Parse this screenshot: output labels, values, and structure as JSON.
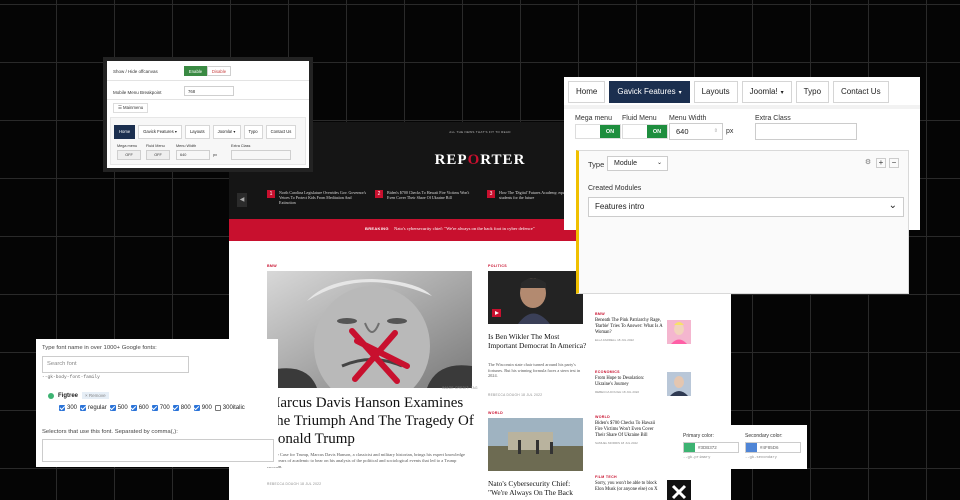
{
  "site": {
    "date_line": "ALL THE NEWS THAT'S FIT TO READ",
    "logo_before": "REP",
    "logo_mark": "O",
    "logo_after": "RTER",
    "ticker": [
      {
        "num": "1",
        "text": "North Carolina Legislature Overrides Gov. Governor's Vetoes To Protect Kids From Meditation And Extinction"
      },
      {
        "num": "2",
        "text": "Biden's $700 Checks To Hawaii Fire Victims Won't Even Cover Their Share Of Ukraine Bill"
      },
      {
        "num": "3",
        "text": "How The 'Digital' Futures Academy, equipping students for the future"
      }
    ],
    "breaking_label": "BREAKING",
    "breaking_text": "Nato's cybersecurity chief: \"We're always on the back foot in cyber defence\"",
    "main_category": "BMW",
    "photo_credit": "IMAGE CREDIT: TAG",
    "headline": "Marcus Davis Hanson Examines The Triumph And The Tragedy Of Donald Trump",
    "excerpt": "In The Case for Trump, Marcus Davis Hanson, a classicist and military historian, brings his expert knowledge from years of academic to bear on his analysis of the political and sociological events that led to a Trump election.",
    "main_byline": "REBECCA DOUGH   18 JUL 2022",
    "mid": [
      {
        "category": "POLITICS",
        "title": "Is Ben Wikler The Most Important Democrat In America?",
        "excerpt": "The Wisconsin state chair turned around his party's fortunes. But his winning formula faces a stern test in 2024.",
        "byline": "REBECCA DOUGH   18 JUL 2022"
      },
      {
        "category": "WORLD",
        "title": "Nato's Cybersecurity Chief: \"We're Always On The Back",
        "excerpt": "",
        "byline": ""
      }
    ],
    "right": [
      {
        "category": "ECONOMICS",
        "title": "The polling data that shows the Tories could recover",
        "byline": "REBECCA DOUGH   18 JUL 2022"
      },
      {
        "category": "BMW",
        "title": "Beneath The Pink Patriarchy Rage, 'Barbie' Tries To Answer: What Is A Woman?",
        "byline": "ELLA FARRELL   18 JUL 2022"
      },
      {
        "category": "ECONOMICS",
        "title": "From Hope to Desolation: Ukraine's Journey",
        "byline": "REBECCA DOUGH   18 JUL 2022"
      },
      {
        "category": "WORLD",
        "title": "Biden's $700 Checks To Hawaii Fire Victims Won't Even Cover Their Share Of Ukraine Bill",
        "byline": "SAMUEL MORRIS   18 JUL 2022"
      },
      {
        "category": "FILM TECH",
        "title": "Sorry, you won't be able to block Elon Musk (or anyone else) on X",
        "byline": ""
      }
    ],
    "colors": {
      "accent": "#c8102e",
      "dark": "#151515"
    }
  },
  "panel_small": {
    "offcanvas_label": "Show / Hide offcanvas",
    "enable_label": "Enable",
    "disable_label": "Disable",
    "breakpoint_label": "Mobile Menu Breakpoint",
    "breakpoint_value": "768",
    "tab_label": "Mainmenu",
    "menu": [
      "Home",
      "Gavick Features ▾",
      "Layouts",
      "Joomla! ▾",
      "Typo",
      "Contact Us"
    ],
    "mega_label": "Mega menu",
    "fluid_label": "Fluid Menu",
    "width_label": "Menu Width",
    "extra_label": "Extra Class",
    "mega_value": "OFF",
    "fluid_value": "OFF",
    "width_value": "640",
    "unit": "px"
  },
  "panel_large": {
    "menu": [
      {
        "label": "Home",
        "caret": ""
      },
      {
        "label": "Gavick Features",
        "caret": "▾"
      },
      {
        "label": "Layouts",
        "caret": ""
      },
      {
        "label": "Joomla!",
        "caret": "▾"
      },
      {
        "label": "Typo",
        "caret": ""
      },
      {
        "label": "Contact Us",
        "caret": ""
      }
    ],
    "mega_label": "Mega menu",
    "fluid_label": "Fluid Menu",
    "width_label": "Menu Width",
    "extra_label": "Extra Class",
    "mega_state": "ON",
    "fluid_state": "ON",
    "width_value": "640",
    "unit": "px",
    "type_label": "Type",
    "type_value": "Module",
    "created_label": "Created Modules",
    "module_value": "Features intro",
    "toggle_color": "#1e8e3e",
    "active_color": "#1b2f4f"
  },
  "font_panel": {
    "search_label": "Type font name in over 1000+ Google fonts:",
    "search_placeholder": "Search font",
    "css_var": "--gk-body-font-family",
    "font_name": "Figtree",
    "font_tag": "Remove",
    "weights": [
      {
        "label": "300",
        "checked": true
      },
      {
        "label": "regular",
        "checked": true
      },
      {
        "label": "500",
        "checked": true
      },
      {
        "label": "600",
        "checked": true
      },
      {
        "label": "700",
        "checked": true
      },
      {
        "label": "800",
        "checked": true
      },
      {
        "label": "900",
        "checked": true
      },
      {
        "label": "300italic",
        "checked": false
      }
    ],
    "selectors_label": "Selectors that use this font. Separated by comma(,):"
  },
  "color_panel": {
    "primary_label": "Primary color:",
    "primary_hex": "#3DB372",
    "primary_var": "--gk-primary",
    "secondary_label": "Secondary color:",
    "secondary_hex": "#4F85D6",
    "secondary_var": "--gk-secondary"
  }
}
